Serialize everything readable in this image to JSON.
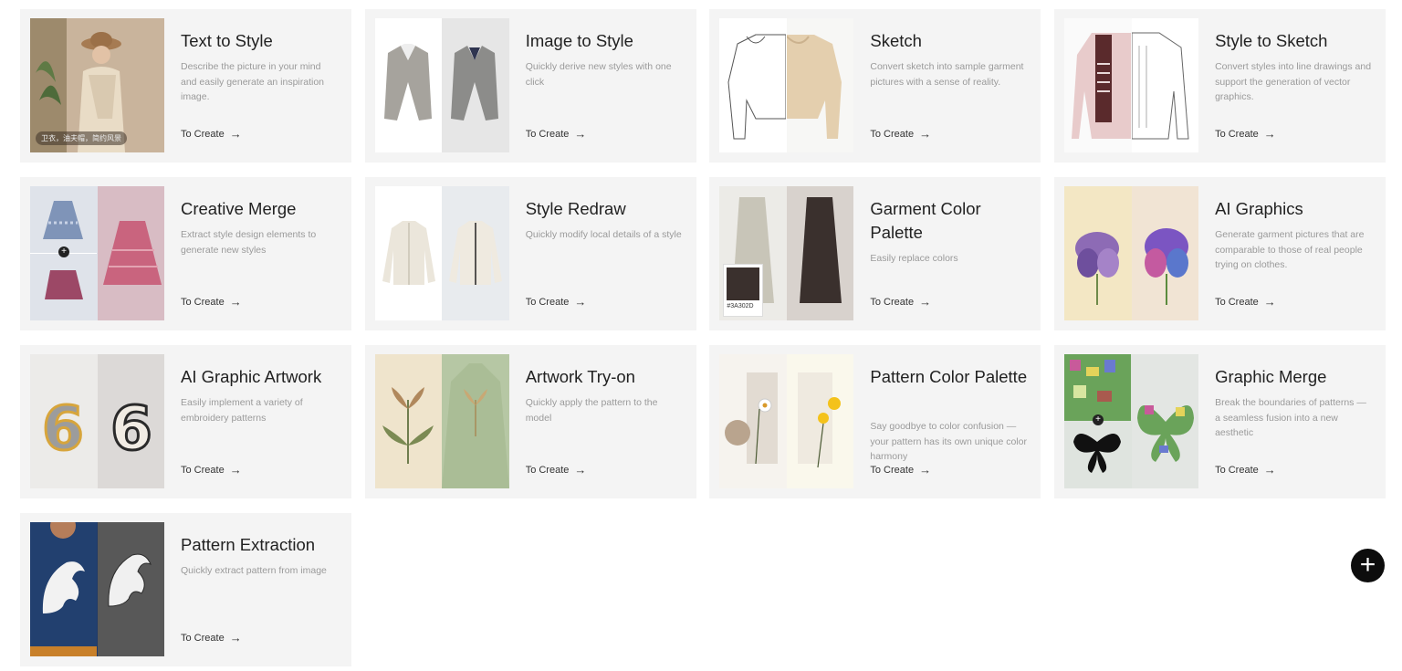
{
  "cta_label": "To Create",
  "cta_arrow": "→",
  "fab_icon": "+",
  "cards": [
    {
      "title": "Text to Style",
      "desc": "Describe the picture in your mind and easily generate an inspiration image.",
      "tag": "卫衣，油夫帽，简约风景"
    },
    {
      "title": "Image to Style",
      "desc": "Quickly derive new styles with one click"
    },
    {
      "title": "Sketch",
      "desc": "Convert sketch into sample garment pictures with a sense of reality."
    },
    {
      "title": "Style to Sketch",
      "desc": "Convert styles into line drawings and support the generation of vector graphics."
    },
    {
      "title": "Creative Merge",
      "desc": "Extract style design elements to generate new styles"
    },
    {
      "title": "Style Redraw",
      "desc": "Quickly modify local details of a style"
    },
    {
      "title": "Garment Color Palette",
      "desc": "Easily replace colors",
      "swatch_hex": "#3A302D"
    },
    {
      "title": "AI Graphics",
      "desc": "Generate garment pictures that are comparable to those of real people trying on clothes."
    },
    {
      "title": "AI Graphic Artwork",
      "desc": "Easily implement a variety of embroidery patterns"
    },
    {
      "title": "Artwork Try-on",
      "desc": "Quickly apply the pattern to the model"
    },
    {
      "title": "Pattern Color Palette",
      "desc": "Say goodbye to color confusion — your pattern has its own unique color harmony"
    },
    {
      "title": "Graphic Merge",
      "desc": "Break the boundaries of patterns — a seamless fusion into a new aesthetic"
    },
    {
      "title": "Pattern Extraction",
      "desc": "Quickly extract pattern from image"
    }
  ]
}
